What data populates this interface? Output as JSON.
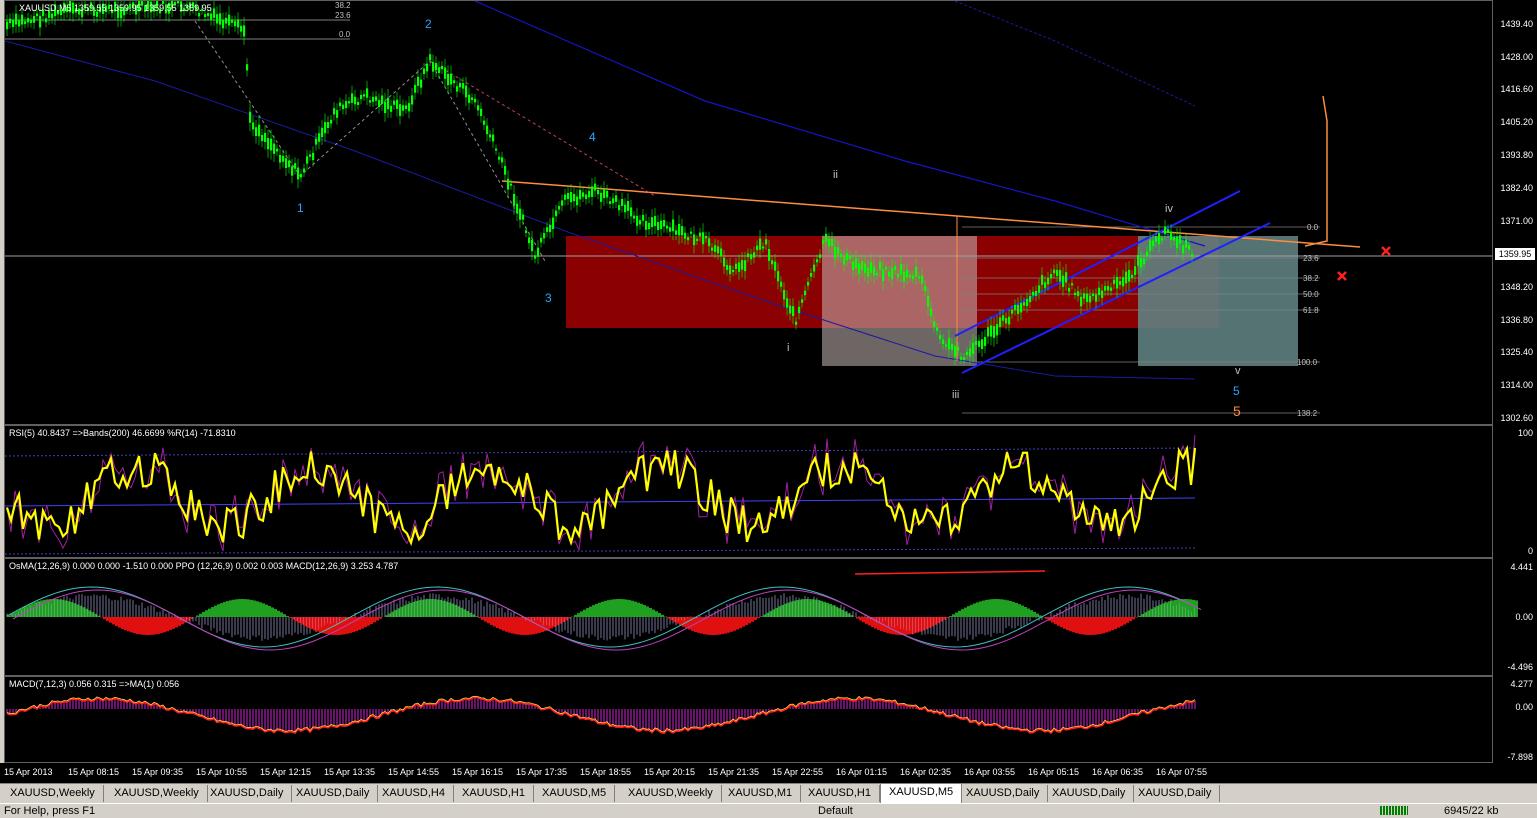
{
  "symbol_header": "XAUUSD,M5  1359.55 1359.95 1359.55 1359.95",
  "current_price": "1359.95",
  "price_scale": [
    "1439.40",
    "1428.00",
    "1416.60",
    "1405.20",
    "1393.80",
    "1382.40",
    "1371.00",
    "1359.60",
    "1348.20",
    "1336.80",
    "1325.40",
    "1314.00",
    "1302.60"
  ],
  "fib_top": [
    "38.2",
    "23.6",
    "0.0"
  ],
  "fib_right": [
    "0.0",
    "23.6",
    "38.2",
    "50.0",
    "61.8",
    "100.0",
    "138.2"
  ],
  "waves": {
    "w1": "1",
    "w2": "2",
    "w3": "3",
    "w4": "4",
    "w5a": "5",
    "w5b": "5",
    "i": "i",
    "ii": "ii",
    "iii": "iii",
    "iv": "iv",
    "v": "v"
  },
  "rsi": {
    "title": "RSI(5) 40.8437  =>Bands(200) 46.6699  %R(14) -71.8310",
    "scale": [
      "100",
      "0"
    ]
  },
  "osma": {
    "title": "OsMA(12,26,9) 0.000 0.000 -1.510 0.000  PPO (12,26,9) 0.002 0.003  MACD(12,26,9) 3.253 4.787",
    "scale": [
      "4.441",
      "0.00",
      "-4.496"
    ]
  },
  "macd": {
    "title": "MACD(7,12,3) 0.056 0.315  =>MA(1) 0.056",
    "scale": [
      "4.277",
      "0.00",
      "-7.898"
    ]
  },
  "time_axis": [
    "15 Apr 2013",
    "15 Apr 08:15",
    "15 Apr 09:35",
    "15 Apr 10:55",
    "15 Apr 12:15",
    "15 Apr 13:35",
    "15 Apr 14:55",
    "15 Apr 16:15",
    "15 Apr 17:35",
    "15 Apr 18:55",
    "15 Apr 20:15",
    "15 Apr 21:35",
    "15 Apr 22:55",
    "16 Apr 01:15",
    "16 Apr 02:35",
    "16 Apr 03:55",
    "16 Apr 05:15",
    "16 Apr 06:35",
    "16 Apr 07:55"
  ],
  "tabs": [
    "XAUUSD,Weekly",
    "XAUUSD,Weekly",
    "XAUUSD,Daily",
    "XAUUSD,Daily",
    "XAUUSD,H4",
    "XAUUSD,H1",
    "XAUUSD,M5",
    "XAUUSD,Weekly",
    "XAUUSD,M1",
    "XAUUSD,H1",
    "XAUUSD,M5",
    "XAUUSD,Daily",
    "XAUUSD,Daily",
    "XAUUSD,Daily"
  ],
  "active_tab_index": 10,
  "status": {
    "help": "For Help, press F1",
    "profile": "Default",
    "traffic": "6945/22 kb"
  },
  "colors": {
    "candle": "#00ff00",
    "rsi": "#ffff00",
    "ma_blue": "#0000ff",
    "trend_orange": "#ff8c40",
    "box_red": "#8b0000",
    "box_gray": "#5f7f7f"
  }
}
